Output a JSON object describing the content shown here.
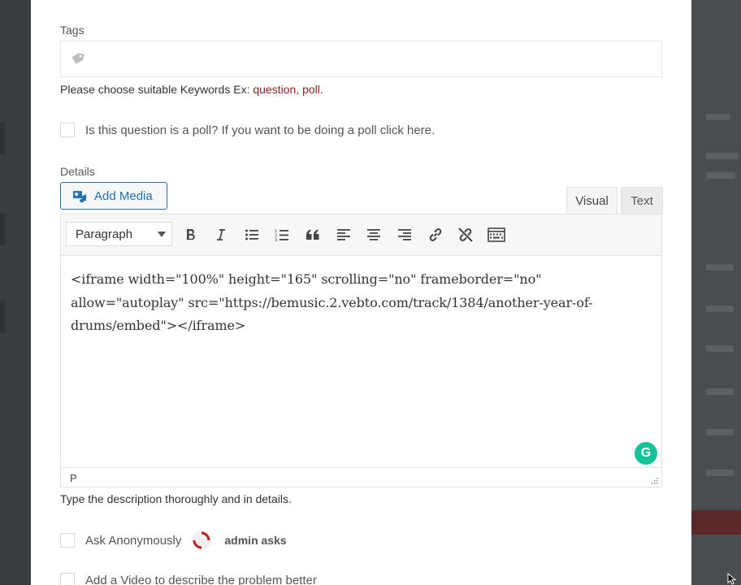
{
  "form": {
    "tags": {
      "label": "Tags",
      "icon": "tag-icon",
      "hint_prefix": "Please choose suitable Keywords Ex: ",
      "hint_keywords": "question, poll",
      "hint_suffix": "."
    },
    "poll": {
      "label": "Is this question is a poll? If you want to be doing a poll click here.",
      "checked": false
    },
    "details": {
      "label": "Details",
      "add_media_label": "Add Media",
      "tabs": {
        "visual": "Visual",
        "text": "Text",
        "active": "visual"
      },
      "toolbar": {
        "format_value": "Paragraph",
        "buttons": [
          "bold-icon",
          "italic-icon",
          "bullet-list-icon",
          "numbered-list-icon",
          "blockquote-icon",
          "align-left-icon",
          "align-center-icon",
          "align-right-icon",
          "link-icon",
          "unlink-icon",
          "toolbar-toggle-icon"
        ]
      },
      "content_lines": [
        "<iframe width=\"100%\" height=\"165\" scrolling=\"no\" frameborder=\"no\"",
        "allow=\"autoplay\" src=\"https://bemusic.2.vebto.com/track/1384/another-year-of-",
        "drums/embed\"></iframe>"
      ],
      "status_path": "P",
      "grammarly_letter": "G",
      "hint": "Type the description thoroughly and in details."
    },
    "anonymous": {
      "label": "Ask Anonymously",
      "user_text": "admin asks",
      "checked": false
    },
    "video": {
      "label": "Add a Video to describe the problem better"
    }
  },
  "colors": {
    "link_blue": "#2271b1",
    "keyword_red": "#8b1c1c",
    "grammarly_green": "#15c39a",
    "overlay": "#3d4043"
  }
}
